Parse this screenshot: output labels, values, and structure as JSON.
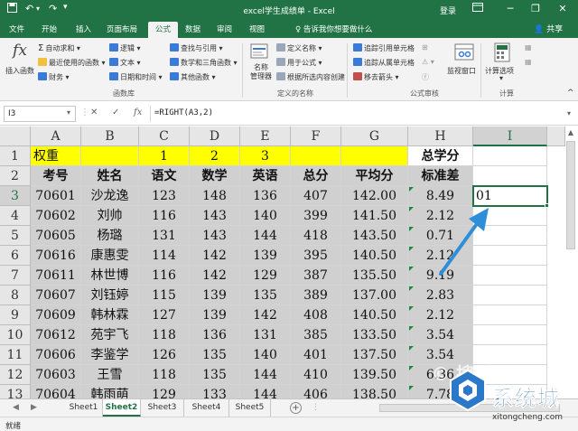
{
  "titlebar": {
    "title": "excel学生成绩单 - Excel",
    "login": "登录",
    "quick_access": {
      "save_icon": "save-icon",
      "undo_icon": "undo-icon",
      "redo_icon": "redo-icon",
      "customize_icon": "customize-icon"
    }
  },
  "ribbon_tabs": {
    "items": [
      "文件",
      "开始",
      "插入",
      "页面布局",
      "公式",
      "数据",
      "审阅",
      "视图"
    ],
    "active_index": 4,
    "tell_me": "♀ 告诉我你想要做什么",
    "share": "共享"
  },
  "ribbon": {
    "insert_function": "插入函数",
    "col1": [
      "自动求和",
      "最近使用的函数",
      "财务"
    ],
    "col2": [
      "逻辑",
      "文本",
      "日期和时间"
    ],
    "col3": [
      "查找与引用",
      "数学和三角函数",
      "其他函数"
    ],
    "group_library": "函数库",
    "name_manager": "名称\n管理器",
    "names": [
      "定义名称",
      "用于公式",
      "根据所选内容创建"
    ],
    "group_names": "定义的名称",
    "audit": [
      "追踪引用单元格",
      "追踪从属单元格",
      "移去箭头"
    ],
    "watch_window": "监视窗口",
    "group_audit": "公式审核",
    "calc_options": "计算选项",
    "group_calc": "计算"
  },
  "formula_bar": {
    "name_box": "I3",
    "cancel": "✕",
    "enter": "✓",
    "fx": "fx",
    "formula": "=RIGHT(A3,2)"
  },
  "grid": {
    "columns": [
      "A",
      "B",
      "C",
      "D",
      "E",
      "F",
      "G",
      "H",
      "I"
    ],
    "selected_column": "I",
    "rows": [
      "1",
      "2",
      "3",
      "4",
      "5",
      "6",
      "7",
      "8",
      "9",
      "10",
      "11",
      "12",
      "13"
    ],
    "selected_row": "3",
    "row1": {
      "a": "权重",
      "c": "1",
      "d": "2",
      "e": "3",
      "h": "总学分"
    },
    "row2": [
      "考号",
      "姓名",
      "语文",
      "数学",
      "英语",
      "总分",
      "平均分",
      "标准差"
    ],
    "data": [
      [
        "70601",
        "沙龙逸",
        "123",
        "148",
        "136",
        "407",
        "142.00",
        "8.49"
      ],
      [
        "70602",
        "刘帅",
        "116",
        "143",
        "140",
        "399",
        "141.50",
        "2.12"
      ],
      [
        "70605",
        "杨璐",
        "131",
        "143",
        "144",
        "418",
        "143.50",
        "0.71"
      ],
      [
        "70616",
        "康惠雯",
        "114",
        "142",
        "139",
        "395",
        "140.50",
        "2.12"
      ],
      [
        "70611",
        "林世博",
        "116",
        "142",
        "129",
        "387",
        "135.50",
        "9.19"
      ],
      [
        "70607",
        "刘钰婷",
        "115",
        "139",
        "135",
        "389",
        "137.00",
        "2.83"
      ],
      [
        "70609",
        "韩林霖",
        "127",
        "139",
        "142",
        "408",
        "140.50",
        "2.12"
      ],
      [
        "70612",
        "苑宇飞",
        "118",
        "136",
        "131",
        "385",
        "133.50",
        "3.54"
      ],
      [
        "70606",
        "李鉴学",
        "126",
        "135",
        "140",
        "401",
        "137.50",
        "3.54"
      ],
      [
        "70603",
        "王雪",
        "118",
        "135",
        "144",
        "410",
        "139.50",
        "6.36"
      ],
      [
        "70604",
        "韩雨萌",
        "129",
        "133",
        "144",
        "406",
        "138.50",
        "7.78"
      ]
    ],
    "i3_value": "01"
  },
  "sheet_tabs": {
    "items": [
      "Sheet1",
      "Sheet2",
      "Sheet3",
      "Sheet4",
      "Sheet5"
    ],
    "active_index": 1,
    "add": "+"
  },
  "status": {
    "text": "就绪"
  },
  "watermark": {
    "name": "系统城",
    "url": "xitongcheng.com"
  },
  "colors": {
    "excel_green": "#217346",
    "highlight_yellow": "#ffff00",
    "selection_gray": "#d0d0d0",
    "arrow_blue": "#2e8fd8"
  }
}
